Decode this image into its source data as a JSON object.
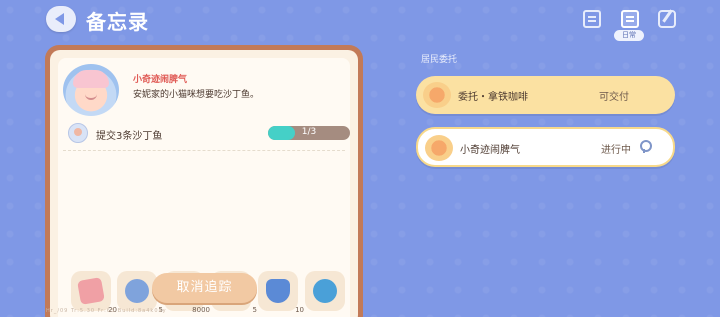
{
  "header": {
    "title": "备忘录",
    "daily_badge": "日常",
    "icons": [
      "back-arrow-icon",
      "book-icon",
      "notebook-icon",
      "edit-icon"
    ]
  },
  "quest_card": {
    "name": "小奇迹闹脾气",
    "description": "安妮家的小猫咪想要吃沙丁鱼。",
    "task": {
      "text": "提交3条沙丁鱼",
      "progress_text": "1/3",
      "progress_fraction": 0.3333
    },
    "rewards": [
      {
        "icon": "pink-ticket-icon",
        "count": "20"
      },
      {
        "icon": "blue-coin-icon",
        "count": "5"
      },
      {
        "icon": "gold-coin-icon",
        "count": "8000"
      },
      {
        "icon": "purple-star-icon",
        "count": "5"
      },
      {
        "icon": "blue-badge-icon",
        "count": "10"
      },
      {
        "icon": "mystery-icon",
        "count": ""
      }
    ],
    "cancel_label": "取消追踪",
    "footer": "Hr_/09 Tr:5.30 Fr:65 Build:8a4k0ay"
  },
  "side_panel": {
    "section_label": "居民委托",
    "items": [
      {
        "title": "委托・拿铁咖啡",
        "status": "可交付"
      },
      {
        "title": "小奇迹闹脾气",
        "status": "进行中"
      }
    ]
  },
  "colors": {
    "background": "#7f98e6",
    "card_frame": "#c27a58",
    "progress_fill": "#45d0c7",
    "item_highlight": "#fbe1a2"
  }
}
